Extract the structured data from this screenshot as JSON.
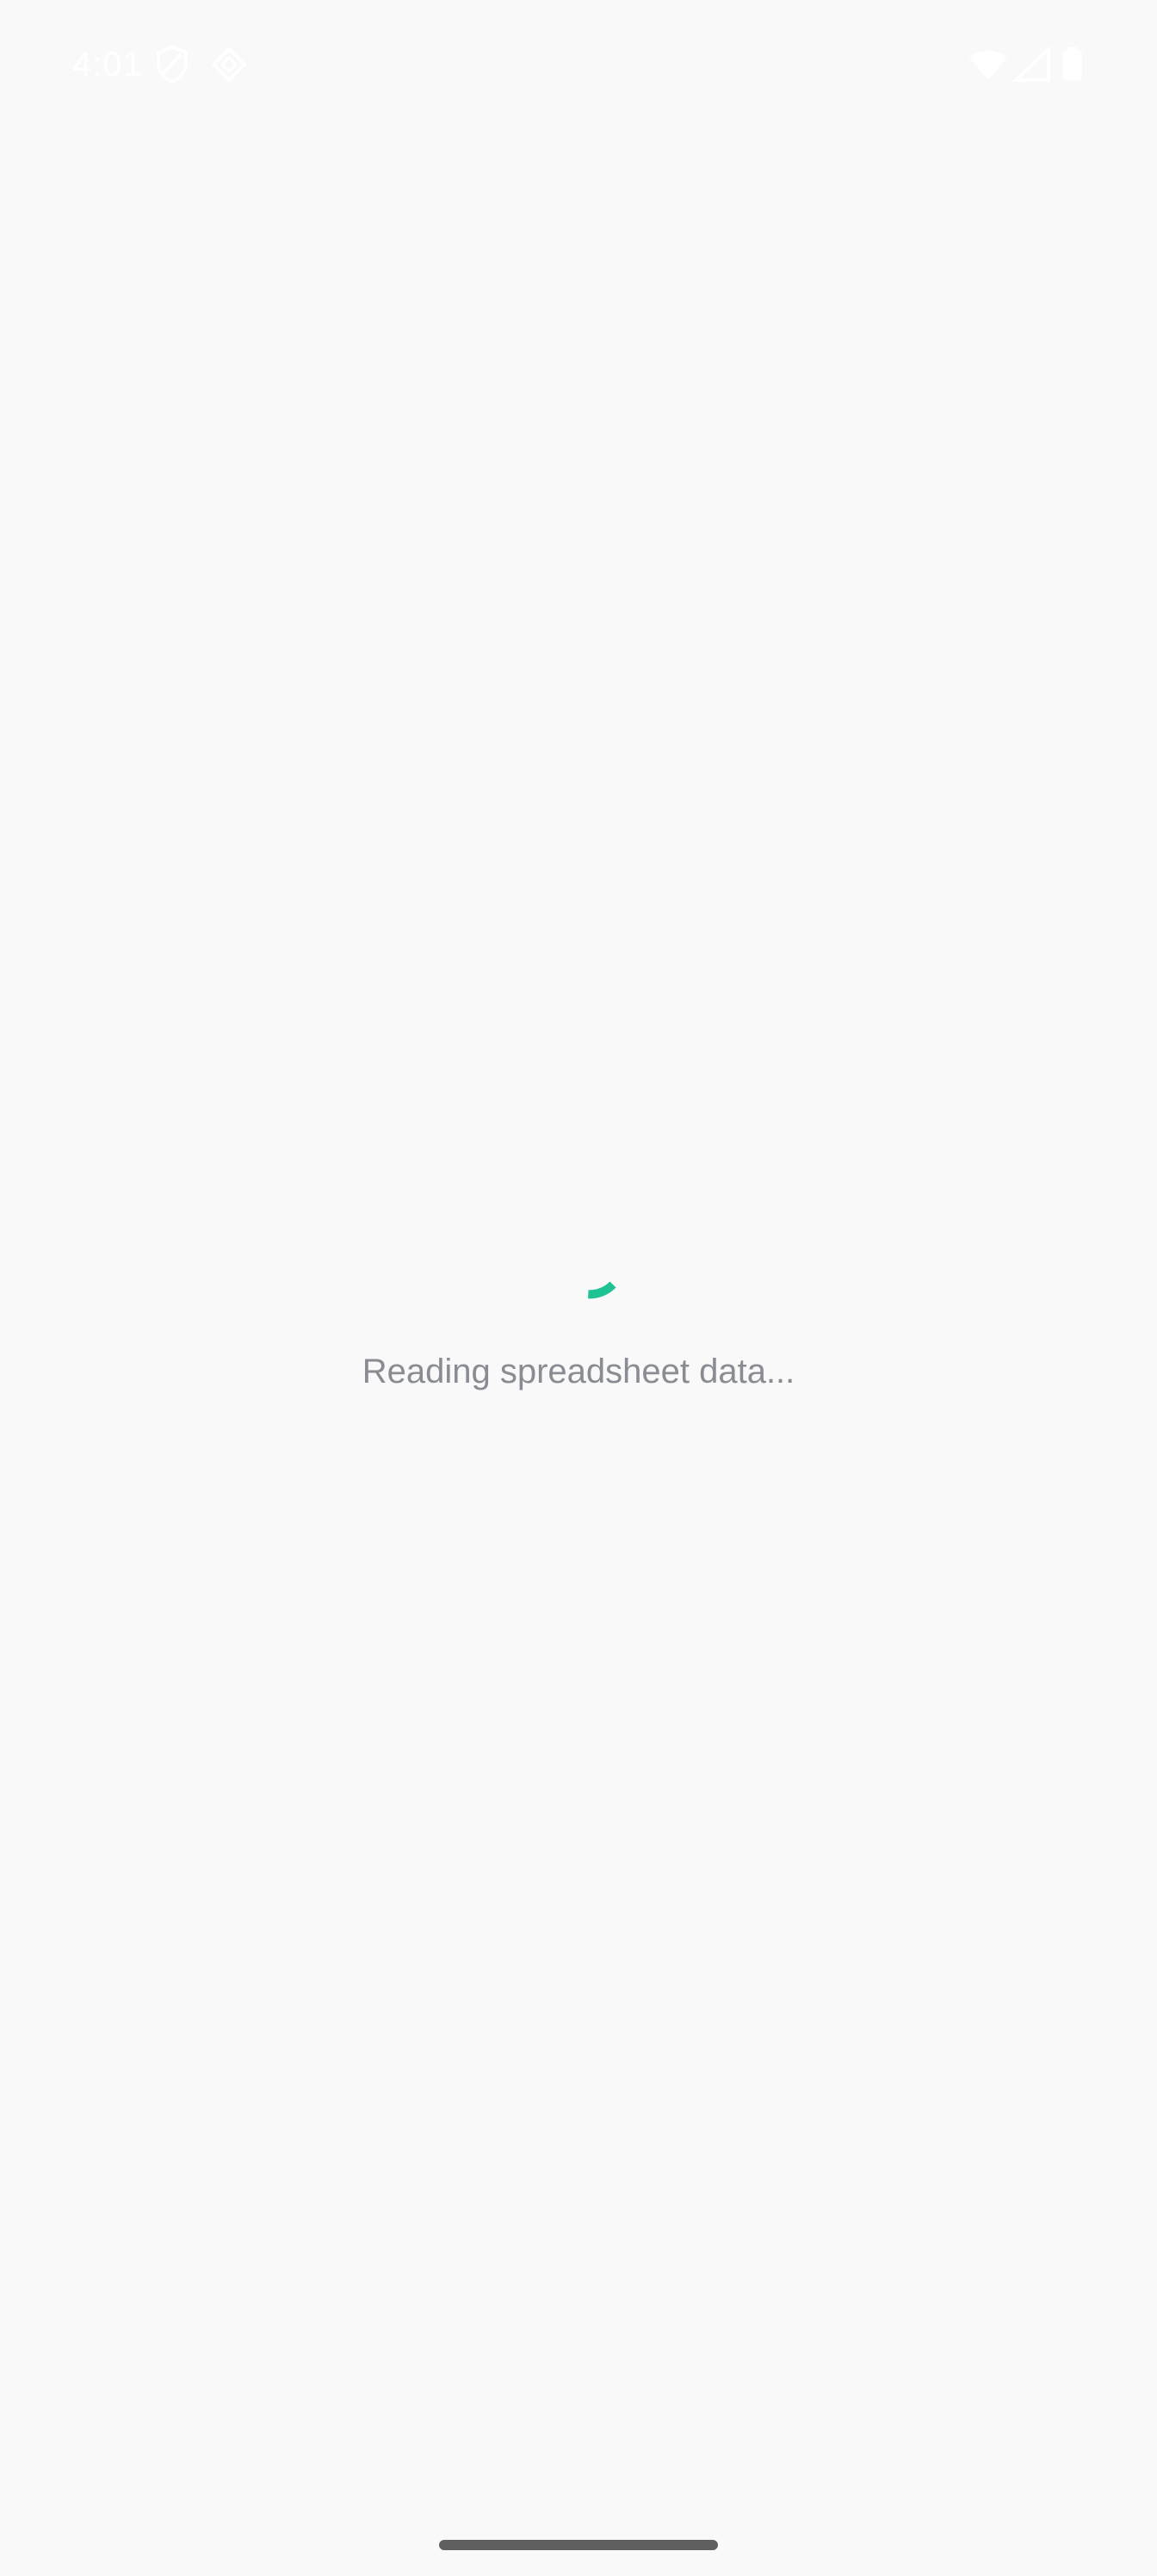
{
  "status_bar": {
    "time": "4:01",
    "left_icons": [
      "shield-icon",
      "diamond-icon"
    ],
    "right_icons": [
      "wifi-icon",
      "cellular-signal-icon",
      "battery-icon"
    ]
  },
  "loading": {
    "message": "Reading spreadsheet data...",
    "spinner_color": "#1fc393"
  },
  "colors": {
    "background": "#f9f9f9",
    "text_muted": "#8a8c93",
    "nav_handle": "#5f5f5f"
  }
}
